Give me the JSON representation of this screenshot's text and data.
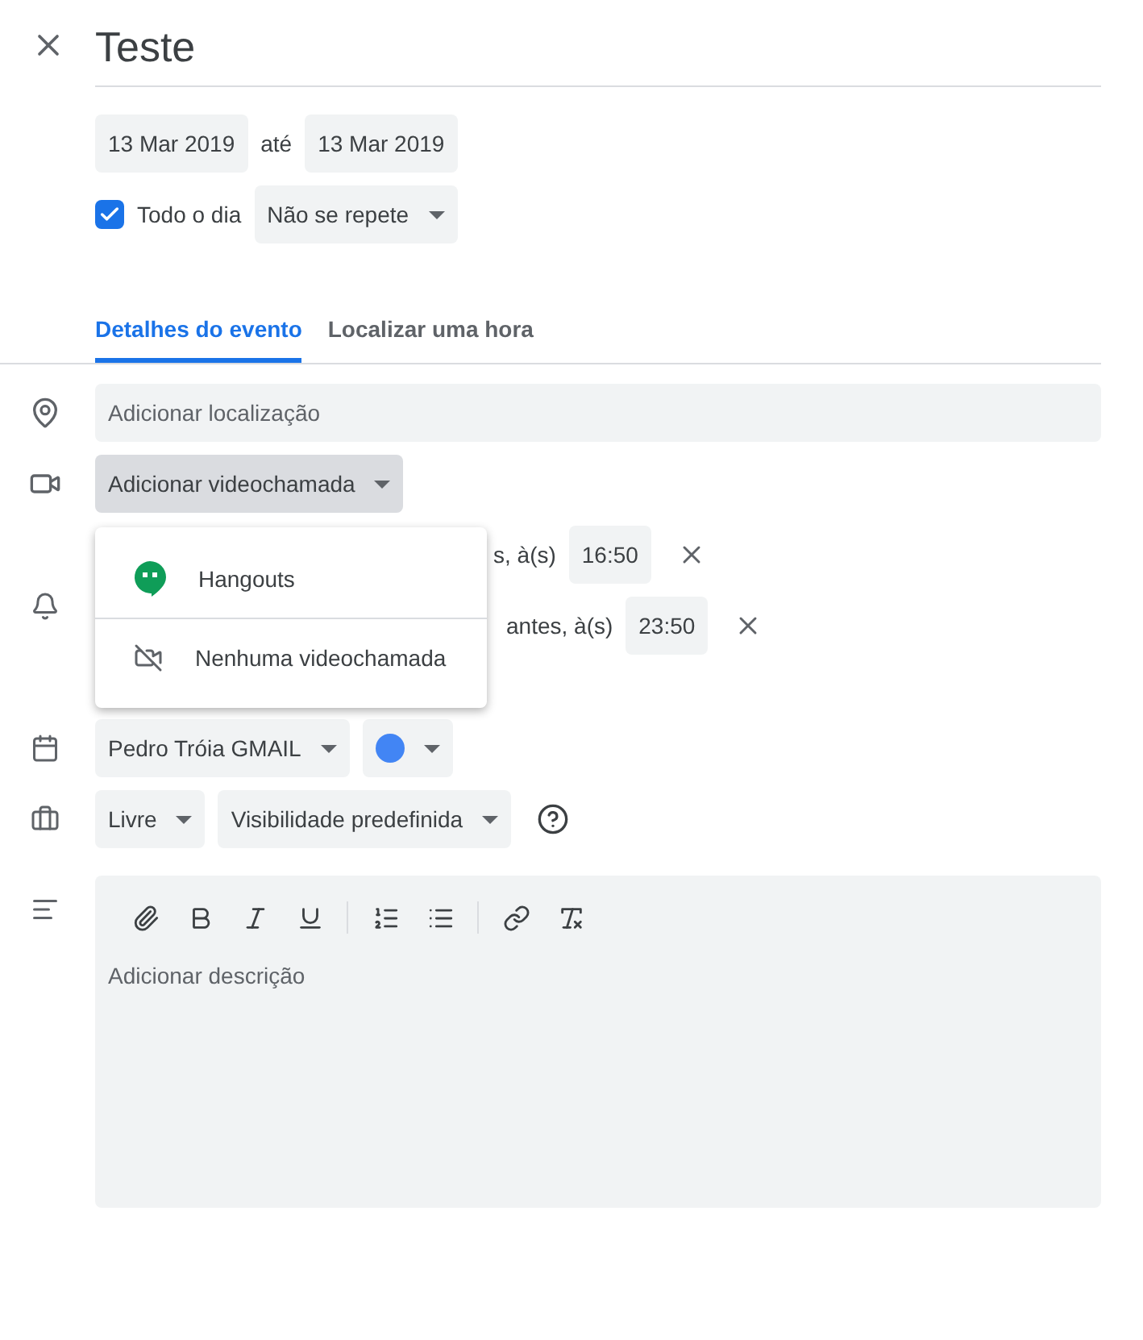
{
  "title": "Teste",
  "dates": {
    "start": "13 Mar 2019",
    "separator": "até",
    "end": "13 Mar 2019"
  },
  "all_day": {
    "label": "Todo o dia",
    "checked": true
  },
  "repeat": {
    "value": "Não se repete"
  },
  "tabs": [
    {
      "label": "Detalhes do evento",
      "selected": true
    },
    {
      "label": "Localizar uma hora",
      "selected": false
    }
  ],
  "location": {
    "placeholder": "Adicionar localização"
  },
  "video_call": {
    "label": "Adicionar videochamada",
    "expanded": true
  },
  "video_menu": [
    {
      "kind": "hangouts",
      "label": "Hangouts"
    },
    {
      "kind": "none",
      "label": "Nenhuma videochamada"
    }
  ],
  "notifications": [
    {
      "text": "s, à(s)",
      "time": "16:50"
    },
    {
      "text": "antes, à(s)",
      "time": "23:50"
    }
  ],
  "calendar": {
    "name": "Pedro Tróia GMAIL",
    "color": "#4285f4"
  },
  "availability": {
    "value": "Livre"
  },
  "visibility": {
    "value": "Visibilidade predefinida"
  },
  "description": {
    "placeholder": "Adicionar descrição"
  }
}
